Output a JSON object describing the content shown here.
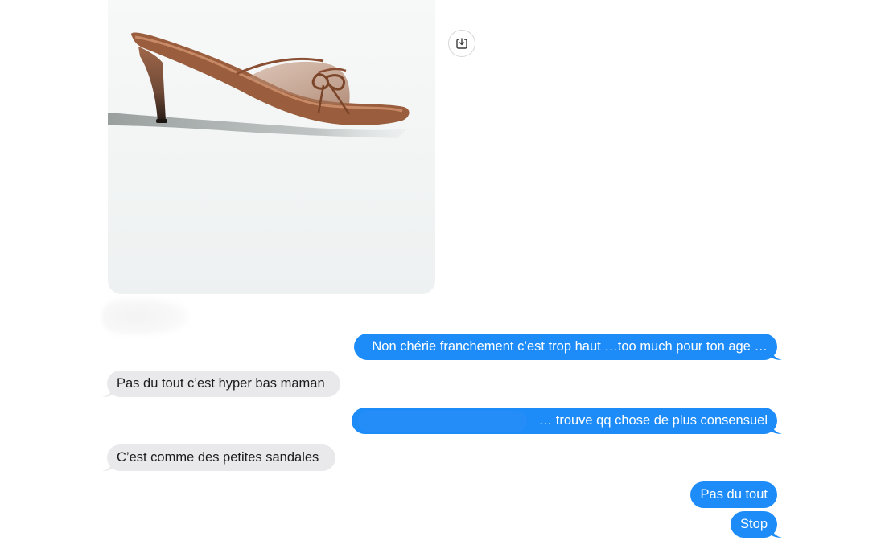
{
  "attachment": {
    "image_alt": "Brown mesh kitten-heel mule sandal with bow",
    "save_icon": "square-arrow-down-icon"
  },
  "colors": {
    "outgoing_bubble": "#1d8cf8",
    "incoming_bubble": "#e9e9eb",
    "outgoing_text": "#ffffff",
    "incoming_text": "#1c1c1e"
  },
  "messages": [
    {
      "direction": "outgoing",
      "text": "Non chérie franchement c’est trop haut …too much pour ton age …"
    },
    {
      "direction": "incoming",
      "text": "Pas du tout c’est hyper bas maman"
    },
    {
      "direction": "outgoing",
      "text": "… trouve  qq chose de plus consensuel"
    },
    {
      "direction": "incoming",
      "text": "C’est comme des petites sandales"
    },
    {
      "direction": "outgoing",
      "text": "Pas du tout"
    },
    {
      "direction": "outgoing",
      "text": "Stop"
    }
  ]
}
